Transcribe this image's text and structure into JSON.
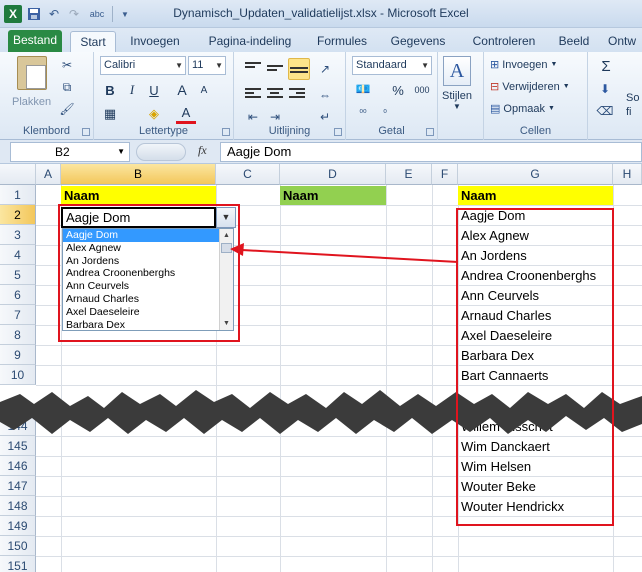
{
  "window": {
    "title": "Dynamisch_Updaten_validatielijst.xlsx - Microsoft Excel",
    "logo": "X",
    "qat_icons": [
      "save-icon",
      "undo-icon",
      "redo-icon",
      "spelling-icon",
      "customize-icon"
    ]
  },
  "tabs": [
    {
      "label": "Bestand"
    },
    {
      "label": "Start"
    },
    {
      "label": "Invoegen"
    },
    {
      "label": "Pagina-indeling"
    },
    {
      "label": "Formules"
    },
    {
      "label": "Gegevens"
    },
    {
      "label": "Controleren"
    },
    {
      "label": "Beeld"
    },
    {
      "label": "Ontw"
    }
  ],
  "ribbon": {
    "clipboard": {
      "label": "Klembord",
      "paste": "Plakken"
    },
    "font": {
      "label": "Lettertype",
      "name": "Calibri",
      "size": "11",
      "bold": "B",
      "italic": "I",
      "underline": "U",
      "grow": "A",
      "shrink": "A",
      "color_a": "A"
    },
    "alignment": {
      "label": "Uitlijning"
    },
    "number": {
      "label": "Getal",
      "format": "Standaard",
      "percent": "%",
      "thousands": "000"
    },
    "styles": {
      "label": "Stijlen",
      "letter": "A"
    },
    "cells": {
      "label": "Cellen",
      "insert": "Invoegen",
      "delete": "Verwijderen",
      "format": "Opmaak"
    },
    "editing": {
      "sigma": "Σ",
      "label1": "So",
      "label2": "fi"
    }
  },
  "formula_bar": {
    "cell_ref": "B2",
    "fx": "fx",
    "value": "Aagje Dom"
  },
  "grid": {
    "columns": [
      "A",
      "B",
      "C",
      "D",
      "E",
      "F",
      "G",
      "H"
    ],
    "rows_top": [
      "1",
      "2",
      "3",
      "4",
      "5",
      "6",
      "7",
      "8",
      "9",
      "10"
    ],
    "rows_bottom": [
      "144",
      "145",
      "146",
      "147",
      "148",
      "149",
      "150",
      "151"
    ],
    "cells": {
      "b1": "Naam",
      "b2": "Aagje Dom",
      "d1": "Naam",
      "g1": "Naam",
      "g_top": [
        "Aagje Dom",
        "Alex Agnew",
        "An Jordens",
        "Andrea Croonenberghs",
        "Ann Ceurvels",
        "Arnaud Charles",
        "Axel Daeseleire",
        "Barbara Dex",
        "Bart Cannaerts"
      ],
      "g144": "Willem Elsschot",
      "g_bottom": [
        "Wim Danckaert",
        "Wim Helsen",
        "Wouter Beke",
        "Wouter Hendrickx"
      ]
    }
  },
  "dropdown": {
    "items": [
      "Aagje Dom",
      "Alex Agnew",
      "An Jordens",
      "Andrea Croonenberghs",
      "Ann Ceurvels",
      "Arnaud Charles",
      "Axel Daeseleire",
      "Barbara Dex"
    ],
    "selected_index": 0
  },
  "colors": {
    "header_yellow": "#ffff00",
    "header_green": "#92d050",
    "highlight": "#e0141e",
    "list_select": "#3399ff"
  }
}
